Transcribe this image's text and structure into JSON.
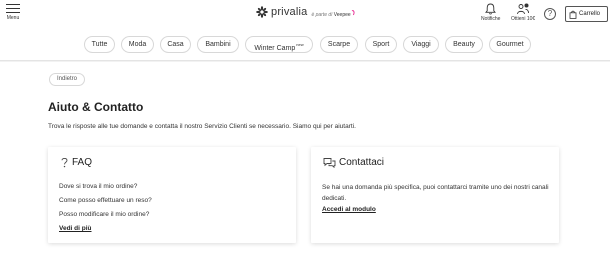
{
  "header": {
    "menu_label": "Menu",
    "logo_word": "privalia",
    "logo_tag": "è parte di",
    "logo_tag_brand": "Veepee",
    "notifications_label": "Notifiche",
    "reward_label": "Ottieni 10€",
    "help_glyph": "?",
    "cart_label": "Carrello",
    "accent_color": "#e5007d"
  },
  "nav": {
    "items": [
      {
        "label": "Tutte"
      },
      {
        "label": "Moda"
      },
      {
        "label": "Casa"
      },
      {
        "label": "Bambini"
      },
      {
        "label": "Winter Camp",
        "badge": "new"
      },
      {
        "label": "Scarpe"
      },
      {
        "label": "Sport"
      },
      {
        "label": "Viaggi"
      },
      {
        "label": "Beauty"
      },
      {
        "label": "Gourmet"
      }
    ]
  },
  "page": {
    "back_label": "Indietro",
    "title": "Aiuto & Contatto",
    "intro": "Trova le risposte alle tue domande e contatta il nostro Servizio Clienti se necessario. Siamo qui per aiutarti."
  },
  "faq_card": {
    "title": "FAQ",
    "questions": [
      "Dove si trova il mio ordine?",
      "Come posso effettuare un reso?",
      "Posso modificare il mio ordine?"
    ],
    "link": "Vedi di più"
  },
  "contact_card": {
    "title": "Contattaci",
    "text": "Se hai una domanda più specifica, puoi contattarci tramite uno dei nostri canali dedicati.",
    "link": "Accedi al modulo"
  }
}
